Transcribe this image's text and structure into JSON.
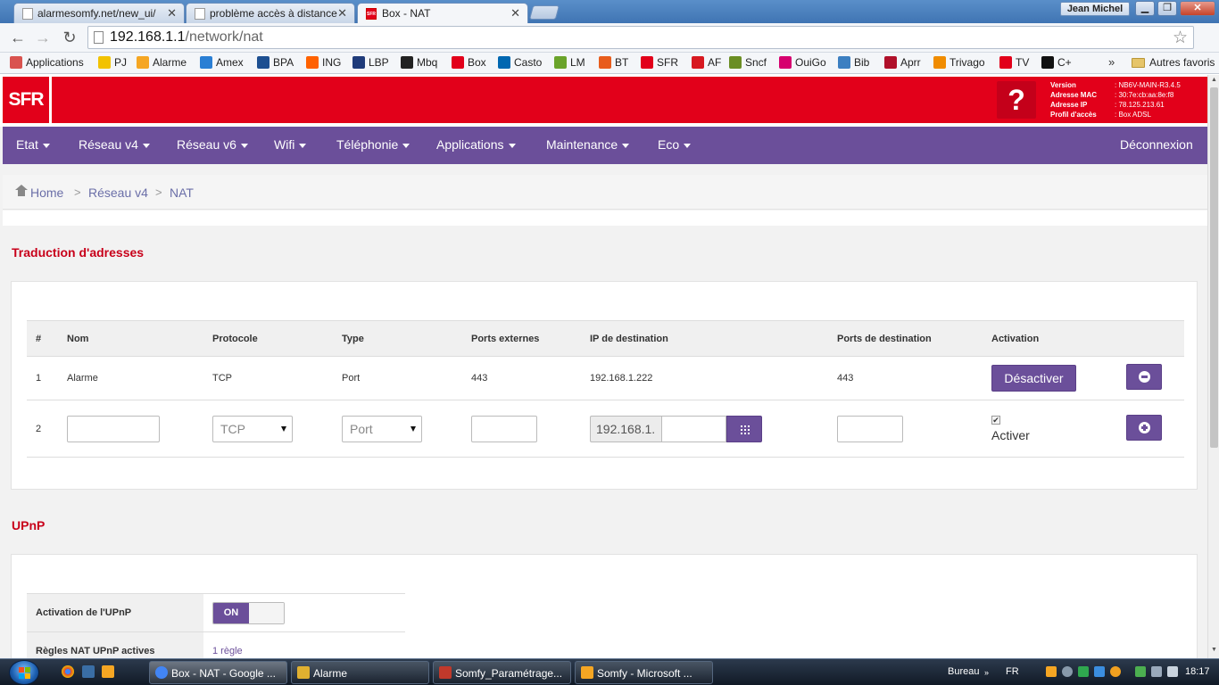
{
  "browser": {
    "tabs": [
      {
        "title": "alarmesomfy.net/new_ui/"
      },
      {
        "title": "problème accès à distance"
      },
      {
        "title": "Box - NAT"
      }
    ],
    "active_tab": 2,
    "user_name": "Jean Michel",
    "url_host": "192.168.1.1",
    "url_path": "/network/nat",
    "bookmarks": [
      {
        "label": "Applications",
        "color": "#d9534f"
      },
      {
        "label": "PJ",
        "color": "#f2c200"
      },
      {
        "label": "Alarme",
        "color": "#f5a623"
      },
      {
        "label": "Amex",
        "color": "#2a7fd4"
      },
      {
        "label": "BPA",
        "color": "#1d4f91"
      },
      {
        "label": "ING",
        "color": "#ff6200"
      },
      {
        "label": "LBP",
        "color": "#1f3b7a"
      },
      {
        "label": "Mbq",
        "color": "#222222"
      },
      {
        "label": "Box",
        "color": "#e2001a"
      },
      {
        "label": "Casto",
        "color": "#0067b1"
      },
      {
        "label": "LM",
        "color": "#6aa32a"
      },
      {
        "label": "BT",
        "color": "#e85d1c"
      },
      {
        "label": "SFR",
        "color": "#e2001a"
      },
      {
        "label": "AF",
        "color": "#d71920"
      },
      {
        "label": "Sncf",
        "color": "#6b8e23"
      },
      {
        "label": "OuiGo",
        "color": "#d6006f"
      },
      {
        "label": "Bib",
        "color": "#3c7fc1"
      },
      {
        "label": "Aprr",
        "color": "#b0102a"
      },
      {
        "label": "Trivago",
        "color": "#f08c00"
      },
      {
        "label": "TV",
        "color": "#e2001a"
      },
      {
        "label": "C+",
        "color": "#111111"
      }
    ],
    "bookmarks_more": "»",
    "other_bookmarks": "Autres favoris"
  },
  "header": {
    "logo": "SFR",
    "help": "?",
    "info": [
      {
        "key": "Version",
        "value": ": NB6V-MAIN-R3.4.5"
      },
      {
        "key": "Adresse MAC",
        "value": ": 30:7e:cb:aa:8e:f8"
      },
      {
        "key": "Adresse IP",
        "value": ": 78.125.213.61"
      },
      {
        "key": "Profil d'accès",
        "value": ": Box ADSL"
      }
    ]
  },
  "nav": {
    "items": [
      "Etat",
      "Réseau v4",
      "Réseau v6",
      "Wifi",
      "Téléphonie",
      "Applications",
      "Maintenance",
      "Eco"
    ],
    "logout": "Déconnexion"
  },
  "breadcrumb": {
    "items": [
      "Home",
      "Réseau v4",
      "NAT"
    ],
    "separator": ">"
  },
  "nat": {
    "title": "Traduction d'adresses",
    "columns": [
      "#",
      "Nom",
      "Protocole",
      "Type",
      "Ports externes",
      "IP de destination",
      "Ports de destination",
      "Activation"
    ],
    "rows": [
      {
        "num": "1",
        "nom": "Alarme",
        "protocole": "TCP",
        "type": "Port",
        "ports_ext": "443",
        "ip_dest": "192.168.1.222",
        "ports_dest": "443",
        "action": "Désactiver"
      }
    ],
    "new_row": {
      "num": "2",
      "protocole": "TCP",
      "type": "Port",
      "ip_prefix": "192.168.1.",
      "checkbox_checked": true,
      "activer_label": "Activer"
    }
  },
  "upnp": {
    "title": "UPnP",
    "rows": [
      {
        "label": "Activation de l'UPnP",
        "toggle": "ON"
      },
      {
        "label": "Règles NAT UPnP actives",
        "value": "1 règle"
      }
    ]
  },
  "taskbar": {
    "tasks": [
      {
        "title": "Box - NAT - Google ...",
        "color": "#4285f4"
      },
      {
        "title": "Alarme",
        "color": "#e0b030"
      },
      {
        "title": "Somfy_Paramétrage...",
        "color": "#c0392b"
      },
      {
        "title": "Somfy - Microsoft ...",
        "color": "#f5a623"
      }
    ],
    "bureau": "Bureau",
    "lang": "FR",
    "clock": "18:17"
  }
}
